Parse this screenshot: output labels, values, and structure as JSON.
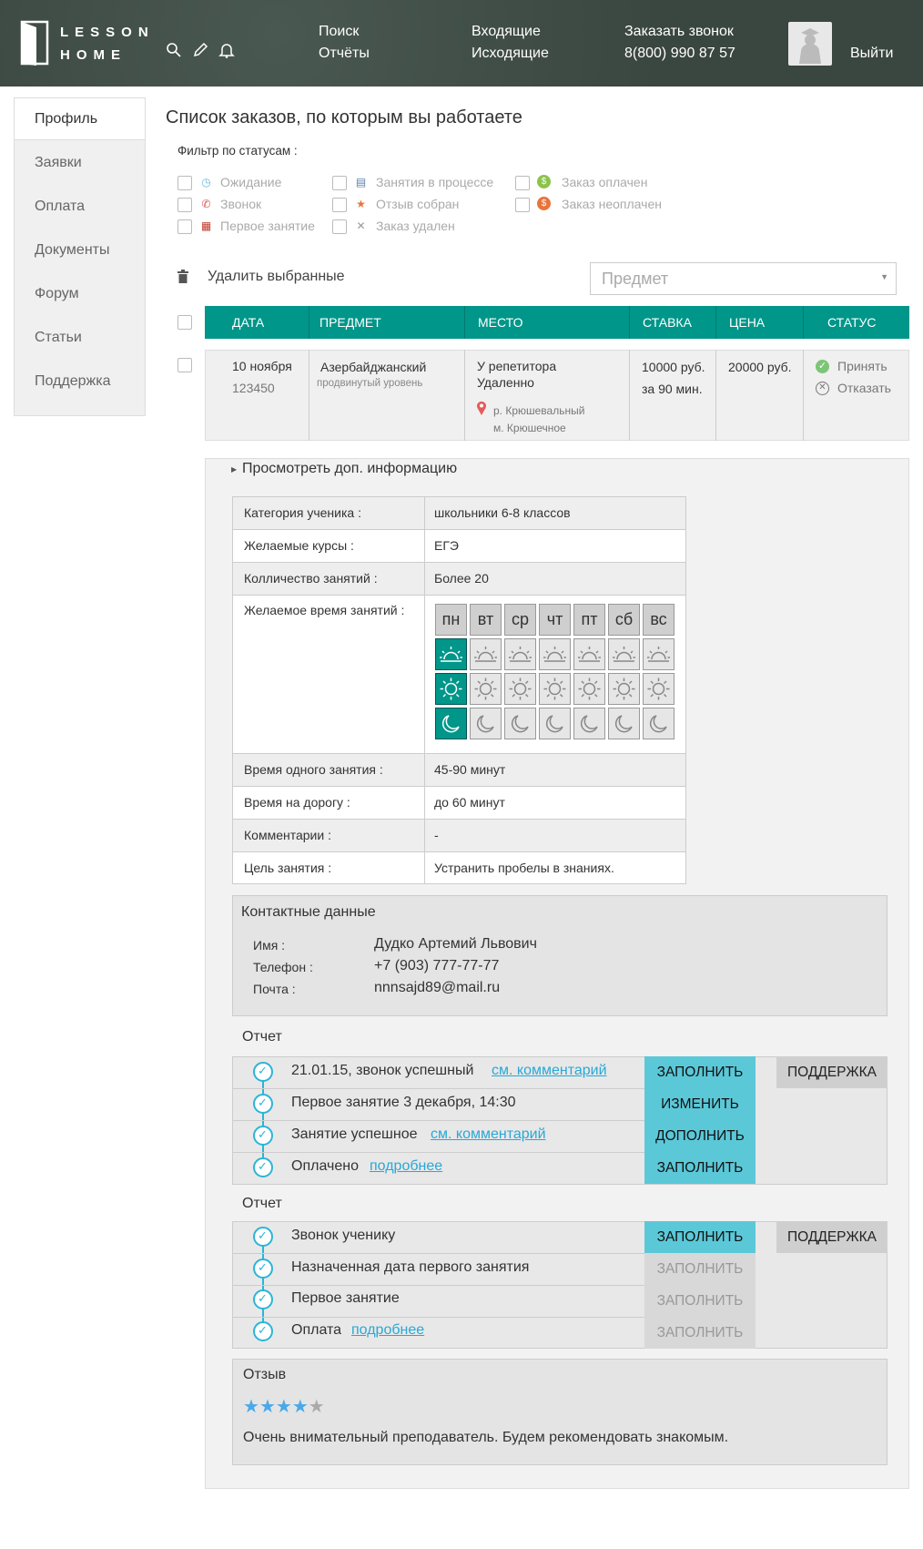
{
  "header": {
    "logo_top": "LESSON",
    "logo_bottom": "HOME",
    "nav_search": "Поиск",
    "nav_reports": "Отчёты",
    "nav_incoming": "Входящие",
    "nav_outgoing": "Исходящие",
    "callback_label": "Заказать звонок",
    "phone": "8(800) 990 87 57",
    "logout": "Выйти",
    "icons": [
      "search-icon",
      "pencil-icon",
      "bell-icon"
    ]
  },
  "sidebar": {
    "items": [
      {
        "label": "Профиль",
        "active": true
      },
      {
        "label": "Заявки"
      },
      {
        "label": "Оплата"
      },
      {
        "label": "Документы"
      },
      {
        "label": "Форум"
      },
      {
        "label": "Статьи"
      },
      {
        "label": "Поддержка"
      }
    ]
  },
  "main": {
    "title": "Список заказов, по которым вы работаете",
    "filter_title": "Фильтр по статусам :",
    "filters": [
      {
        "label": "Ожидание",
        "icon": "clock-icon"
      },
      {
        "label": "Звонок",
        "icon": "phone-icon"
      },
      {
        "label": "Первое занятие",
        "icon": "calendar-icon"
      },
      {
        "label": "Занятия в процессе",
        "icon": "book-icon"
      },
      {
        "label": "Отзыв собран",
        "icon": "star-icon"
      },
      {
        "label": "Заказ удален",
        "icon": "cross-icon"
      },
      {
        "label": "Заказ оплачен",
        "icon": "coin-green-icon"
      },
      {
        "label": "Заказ неоплачен",
        "icon": "coin-orange-icon"
      }
    ],
    "delete_selected": "Удалить выбранные",
    "subject_placeholder": "Предмет"
  },
  "table": {
    "headers": [
      "ДАТА",
      "ПРЕДМЕТ",
      "МЕСТО",
      "СТАВКА",
      "ЦЕНА",
      "СТАТУС"
    ],
    "row": {
      "date": "10 ноября",
      "id": "123450",
      "subject": "Азербайджанский",
      "level": "продвинутый уровень",
      "place1": "У репетитора",
      "place2": "Удаленно",
      "district": "р. Крюшевальный",
      "metro": "м. Крюшечное",
      "rate1": "10000 руб.",
      "rate2": "за 90 мин.",
      "price": "20000 руб.",
      "accept": "Принять",
      "decline": "Отказать"
    }
  },
  "details": {
    "toggle": "Просмотреть доп. информацию",
    "rows": [
      {
        "label": "Категория ученика :",
        "value": "школьники 6-8 классов"
      },
      {
        "label": "Желаемые курсы  :",
        "value": "ЕГЭ"
      },
      {
        "label": "Колличество занятий  :",
        "value": "Более 20"
      },
      {
        "label": "Желаемое время занятий  :",
        "value": ""
      },
      {
        "label": "Время одного занятия  :",
        "value": "45-90 минут"
      },
      {
        "label": "Время на дорогу  :",
        "value": "до 60 минут"
      },
      {
        "label": "Комментарии :",
        "value": "-"
      },
      {
        "label": "Цель занятия :",
        "value": "Устранить пробелы в знаниях."
      }
    ],
    "days": [
      "пн",
      "вт",
      "ср",
      "чт",
      "пт",
      "сб",
      "вс"
    ],
    "time_slots": [
      "sunrise-icon",
      "sun-icon",
      "moon-icon"
    ],
    "selected_day": "пн"
  },
  "contact": {
    "title": "Контактные данные",
    "name_label": "Имя :",
    "name": "Дудко Артемий Львович",
    "phone_label": "Телефон :",
    "phone": "+7 (903) 777-77-77",
    "email_label": "Почта :",
    "email": "nnnsajd89@mail.ru"
  },
  "report1": {
    "title": "Отчет",
    "items": [
      {
        "text": "21.01.15, звонок успешный",
        "link": "см. комментарий",
        "button": "ЗАПОЛНИТЬ",
        "active": true
      },
      {
        "text": "Первое занятие 3 декабря, 14:30",
        "link": "",
        "button": "ИЗМЕНИТЬ",
        "active": true
      },
      {
        "text": "Занятие успешное",
        "link": "см. комментарий",
        "button": "ДОПОЛНИТЬ",
        "active": true
      },
      {
        "text": "Оплачено",
        "link": "подробнее",
        "button": "ЗАПОЛНИТЬ",
        "active": true
      }
    ],
    "support": "ПОДДЕРЖКА"
  },
  "report2": {
    "title": "Отчет",
    "items": [
      {
        "text": "Звонок ученику",
        "link": "",
        "button": "ЗАПОЛНИТЬ",
        "active": true
      },
      {
        "text": "Назначенная дата первого занятия",
        "link": "",
        "button": "ЗАПОЛНИТЬ",
        "active": false
      },
      {
        "text": "Первое занятие",
        "link": "",
        "button": "ЗАПОЛНИТЬ",
        "active": false
      },
      {
        "text": "Оплата",
        "link": "подробнее",
        "button": "ЗАПОЛНИТЬ",
        "active": false
      }
    ],
    "support": "ПОДДЕРЖКА"
  },
  "review": {
    "title": "Отзыв",
    "rating": 4,
    "max": 5,
    "text": "Очень внимательный преподаватель. Будем рекомендовать знакомым."
  },
  "colors": {
    "teal": "#00968a",
    "button_cyan": "#5bc8d8",
    "link": "#29a8d6",
    "header_bg": "#3d4a44"
  }
}
